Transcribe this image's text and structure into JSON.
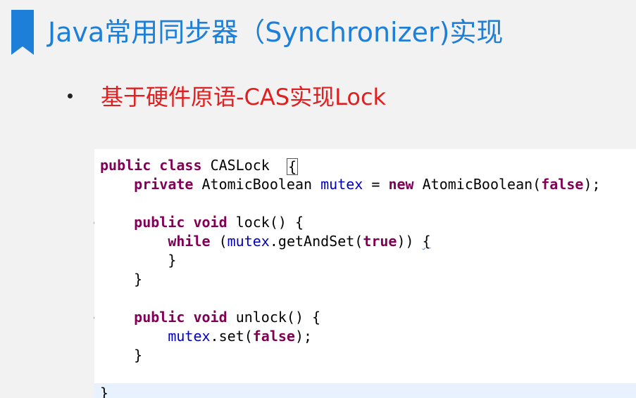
{
  "slide": {
    "title": "Java常用同步器（Synchronizer)实现",
    "accent_color": "#1e7fd8",
    "bullet_color": "#e02020",
    "bullets": [
      {
        "text": "基于硬件原语-CAS实现Lock"
      }
    ]
  },
  "code": {
    "language": "java",
    "colors": {
      "keyword": "#7f0055",
      "field": "#0000c0",
      "plain": "#000000",
      "line_highlight": "#e8f2fe"
    },
    "tokens": {
      "public": "public",
      "class": "class",
      "private": "private",
      "new": "new",
      "void": "void",
      "while": "while",
      "true": "true",
      "false": "false",
      "class_name": "CASLock",
      "atomic_type": "AtomicBoolean",
      "mutex": "mutex",
      "lock_sig": "lock() {",
      "unlock_sig": "unlock() {",
      "getAndSet": ".getAndSet(",
      "set": ".set(",
      "open_brace": "{",
      "close_brace": "}"
    }
  }
}
